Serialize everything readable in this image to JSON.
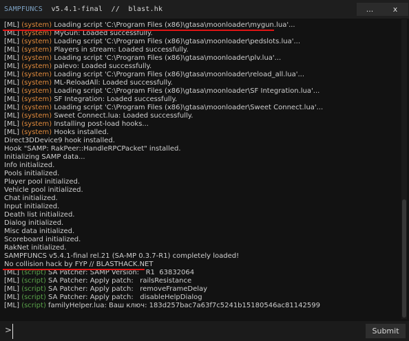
{
  "window": {
    "title_brand": "SAMPFUNCS",
    "title_rest": "  v5.4.1-final  //  blast.hk",
    "minimize_label": "...",
    "close_label": "x"
  },
  "log": [
    {
      "prefix": "[ML] ",
      "tag": "(system)",
      "tag_type": "system",
      "text": " Loading script 'C:\\Program Files (x86)\\gtasa\\moonloader\\mygun.lua'..."
    },
    {
      "prefix": "[ML] ",
      "tag": "(system)",
      "tag_type": "system",
      "text": " MyGun: Loaded successfully."
    },
    {
      "prefix": "[ML] ",
      "tag": "(system)",
      "tag_type": "system",
      "text": " Loading script 'C:\\Program Files (x86)\\gtasa\\moonloader\\pedslots.lua'..."
    },
    {
      "prefix": "[ML] ",
      "tag": "(system)",
      "tag_type": "system",
      "text": " Players in stream: Loaded successfully."
    },
    {
      "prefix": "[ML] ",
      "tag": "(system)",
      "tag_type": "system",
      "text": " Loading script 'C:\\Program Files (x86)\\gtasa\\moonloader\\plv.lua'..."
    },
    {
      "prefix": "[ML] ",
      "tag": "(system)",
      "tag_type": "system",
      "text": " palevo: Loaded successfully."
    },
    {
      "prefix": "[ML] ",
      "tag": "(system)",
      "tag_type": "system",
      "text": " Loading script 'C:\\Program Files (x86)\\gtasa\\moonloader\\reload_all.lua'..."
    },
    {
      "prefix": "[ML] ",
      "tag": "(system)",
      "tag_type": "system",
      "text": " ML-ReloadAll: Loaded successfully."
    },
    {
      "prefix": "[ML] ",
      "tag": "(system)",
      "tag_type": "system",
      "text": " Loading script 'C:\\Program Files (x86)\\gtasa\\moonloader\\SF Integration.lua'..."
    },
    {
      "prefix": "[ML] ",
      "tag": "(system)",
      "tag_type": "system",
      "text": " SF Integration: Loaded successfully."
    },
    {
      "prefix": "[ML] ",
      "tag": "(system)",
      "tag_type": "system",
      "text": " Loading script 'C:\\Program Files (x86)\\gtasa\\moonloader\\Sweet Connect.lua'..."
    },
    {
      "prefix": "[ML] ",
      "tag": "(system)",
      "tag_type": "system",
      "text": " Sweet Connect.lua: Loaded successfully."
    },
    {
      "prefix": "[ML] ",
      "tag": "(system)",
      "tag_type": "system",
      "text": " Installing post-load hooks..."
    },
    {
      "prefix": "[ML] ",
      "tag": "(system)",
      "tag_type": "system",
      "text": " Hooks installed."
    },
    {
      "prefix": "",
      "tag": "",
      "tag_type": "none",
      "text": "Direct3DDevice9 hook installed."
    },
    {
      "prefix": "",
      "tag": "",
      "tag_type": "none",
      "text": "Hook \"SAMP: RakPeer::HandleRPCPacket\" installed."
    },
    {
      "prefix": "",
      "tag": "",
      "tag_type": "none",
      "text": "Initializing SAMP data..."
    },
    {
      "prefix": "",
      "tag": "",
      "tag_type": "none",
      "text": "Info initialized."
    },
    {
      "prefix": "",
      "tag": "",
      "tag_type": "none",
      "text": "Pools initialized."
    },
    {
      "prefix": "",
      "tag": "",
      "tag_type": "none",
      "text": "Player pool initialized."
    },
    {
      "prefix": "",
      "tag": "",
      "tag_type": "none",
      "text": "Vehicle pool initialized."
    },
    {
      "prefix": "",
      "tag": "",
      "tag_type": "none",
      "text": "Chat initialized."
    },
    {
      "prefix": "",
      "tag": "",
      "tag_type": "none",
      "text": "Input initialized."
    },
    {
      "prefix": "",
      "tag": "",
      "tag_type": "none",
      "text": "Death list initialized."
    },
    {
      "prefix": "",
      "tag": "",
      "tag_type": "none",
      "text": "Dialog initialized."
    },
    {
      "prefix": "",
      "tag": "",
      "tag_type": "none",
      "text": "Misc data initialized."
    },
    {
      "prefix": "",
      "tag": "",
      "tag_type": "none",
      "text": "Scoreboard initialized."
    },
    {
      "prefix": "",
      "tag": "",
      "tag_type": "none",
      "text": "RakNet initialized."
    },
    {
      "prefix": "",
      "tag": "",
      "tag_type": "none",
      "text": "SAMPFUNCS v5.4.1-final rel.21 (SA-MP 0.3.7-R1) completely loaded!"
    },
    {
      "prefix": "",
      "tag": "",
      "tag_type": "none",
      "text": "No collision hack by FYP // BLASTHACK.NET"
    },
    {
      "prefix": "[ML] ",
      "tag": "(script)",
      "tag_type": "script",
      "text": " SA Patcher: SAMP Version:   R1  63832064"
    },
    {
      "prefix": "[ML] ",
      "tag": "(script)",
      "tag_type": "script",
      "text": " SA Patcher: Apply patch:   railsResistance"
    },
    {
      "prefix": "[ML] ",
      "tag": "(script)",
      "tag_type": "script",
      "text": " SA Patcher: Apply patch:   removeFrameDelay"
    },
    {
      "prefix": "[ML] ",
      "tag": "(script)",
      "tag_type": "script",
      "text": " SA Patcher: Apply patch:   disableHelpDialog"
    },
    {
      "prefix": "[ML] ",
      "tag": "(script)",
      "tag_type": "script",
      "text": " familyHelper.lua: Ваш ключ: 183d257bac7a63f7c5241b15180546ac81142599"
    }
  ],
  "input": {
    "prompt": ">",
    "value": "",
    "submit_label": "Submit"
  }
}
